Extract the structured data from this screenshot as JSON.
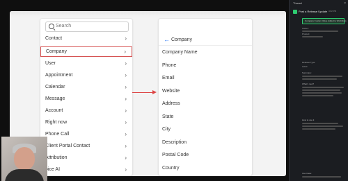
{
  "left_panel": {
    "search_placeholder": "Search",
    "items": [
      {
        "label": "Contact"
      },
      {
        "label": "Company"
      },
      {
        "label": "User"
      },
      {
        "label": "Appointment"
      },
      {
        "label": "Calendar"
      },
      {
        "label": "Message"
      },
      {
        "label": "Account"
      },
      {
        "label": "Right now"
      },
      {
        "label": "Phone Call"
      },
      {
        "label": "Client Portal Contact"
      },
      {
        "label": "Attribution"
      },
      {
        "label": "oice AI"
      }
    ]
  },
  "right_panel": {
    "title": "Company",
    "fields": [
      "Company Name",
      "Phone",
      "Email",
      "Website",
      "Address",
      "State",
      "City",
      "Description",
      "Postal Code",
      "Country"
    ]
  },
  "thread": {
    "title": "Thread",
    "close_icon": "×",
    "author": "Post a Release Update",
    "time": "4:02 PM",
    "chip": "Company Custom Value Added to Workflows",
    "lines": [
      "Owner:",
      "Product:",
      "Release Type:",
      "Label:",
      "Summary:",
      "What's new?",
      "How to use it",
      "Use Case:"
    ]
  },
  "colors": {
    "accent_red": "#d65353",
    "accent_blue": "#3b82f6",
    "thread_bg": "#1b1d21"
  }
}
